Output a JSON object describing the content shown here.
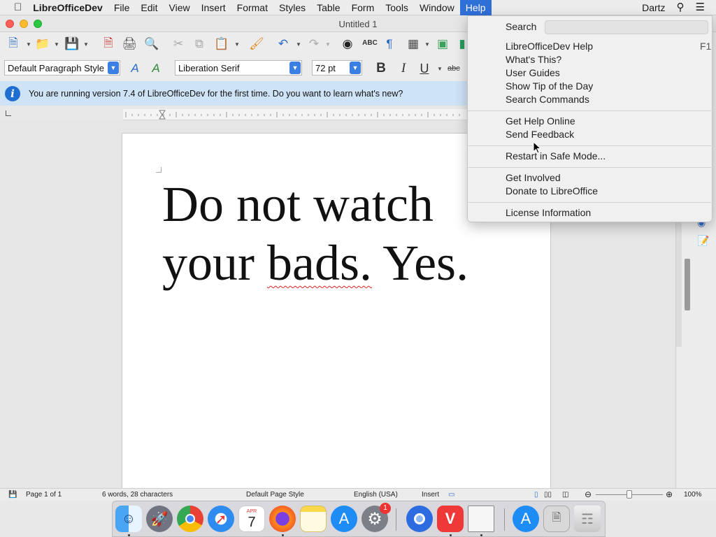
{
  "menubar": {
    "app": "LibreOfficeDev",
    "items": [
      "File",
      "Edit",
      "View",
      "Insert",
      "Format",
      "Styles",
      "Table",
      "Form",
      "Tools",
      "Window",
      "Help"
    ],
    "user": "Dartz"
  },
  "window": {
    "title": "Untitled 1"
  },
  "formatting": {
    "paragraph_style": "Default Paragraph Style",
    "font_name": "Liberation Serif",
    "font_size": "72 pt",
    "bold": "B",
    "italic": "I",
    "underline": "U",
    "strikethrough": "abc"
  },
  "infobar": {
    "message": "You are running version 7.4 of LibreOfficeDev for the first time. Do you want to learn what's new?"
  },
  "document": {
    "line1": "Do not watch",
    "line2_a": "your ",
    "line2_misspelled": "bads.",
    "line2_b": " Yes."
  },
  "status": {
    "page": "Page 1 of 1",
    "words": "6 words, 28 characters",
    "page_style": "Default Page Style",
    "language": "English (USA)",
    "mode": "Insert",
    "zoom": "100%"
  },
  "help_menu": {
    "search_label": "Search",
    "items": [
      {
        "label": "LibreOfficeDev Help",
        "shortcut": "F1"
      },
      {
        "label": "What's This?"
      },
      {
        "label": "User Guides"
      },
      {
        "label": "Show Tip of the Day"
      },
      {
        "label": "Search Commands"
      },
      {
        "label": "Get Help Online"
      },
      {
        "label": "Send Feedback"
      },
      {
        "label": "Restart in Safe Mode..."
      },
      {
        "label": "Get Involved"
      },
      {
        "label": "Donate to LibreOffice"
      },
      {
        "label": "License Information"
      }
    ]
  },
  "dock": {
    "calendar_month": "APR",
    "calendar_day": "7",
    "settings_badge": "1"
  },
  "colors": {
    "accent": "#2f6fd8",
    "infobar": "#cfe3f7",
    "misspell": "#e02020"
  }
}
